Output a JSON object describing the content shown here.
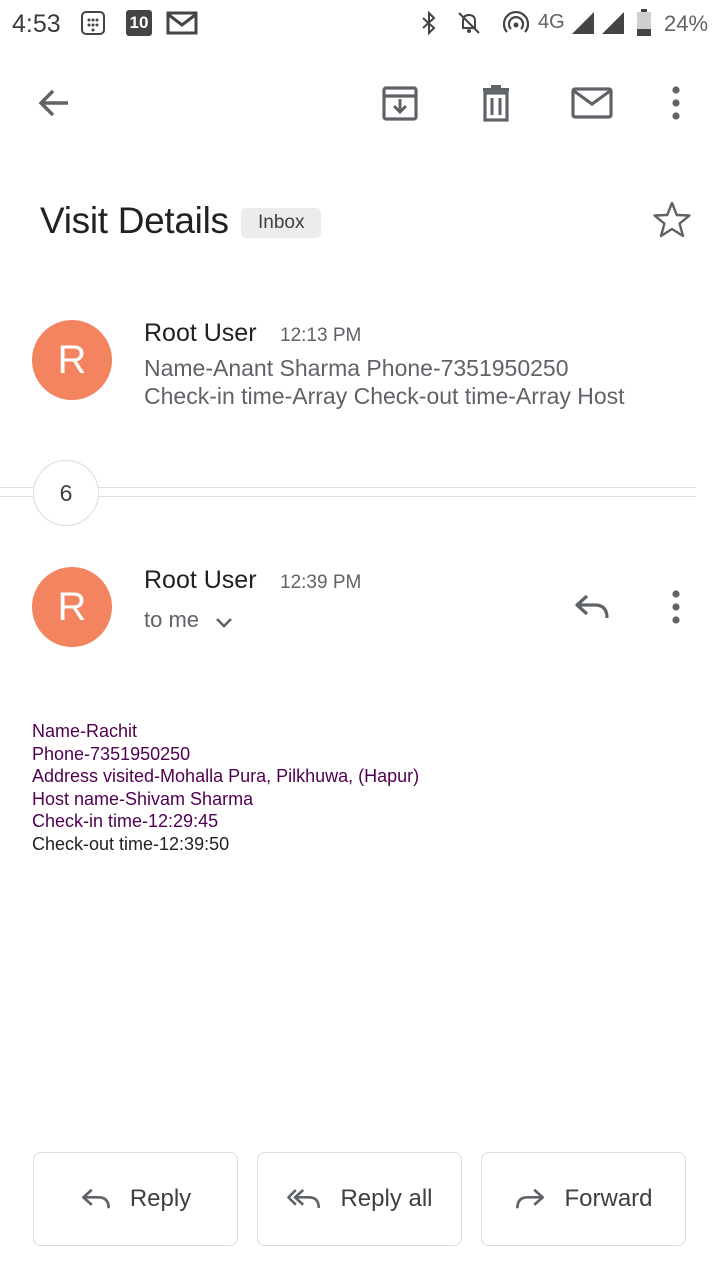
{
  "status_bar": {
    "time": "4:53",
    "notification_badge": "10",
    "network": "4G",
    "battery": "24%"
  },
  "toolbar": {
    "back_icon": "arrow-back-icon",
    "archive_icon": "archive-icon",
    "delete_icon": "delete-icon",
    "mark_unread_icon": "mail-icon",
    "more_icon": "more-vert-icon"
  },
  "email": {
    "subject": "Visit Details",
    "label": "Inbox"
  },
  "message_1": {
    "avatar_letter": "R",
    "sender": "Root User",
    "time": "12:13 PM",
    "snippet_line1": "Name-Anant Sharma Phone-7351950250",
    "snippet_line2": "Check-in time-Array Check-out time-Array Host"
  },
  "collapsed_count": "6",
  "message_2": {
    "avatar_letter": "R",
    "sender": "Root User",
    "time": "12:39 PM",
    "recipient": "to me",
    "body": [
      "Name-Rachit",
      "Phone-7351950250",
      "Address visited-Mohalla Pura, Pilkhuwa, (Hapur)",
      "Host name-Shivam Sharma",
      "Check-in time-12:29:45",
      "Check-out time-12:39:50"
    ]
  },
  "actions": {
    "reply": "Reply",
    "reply_all": "Reply all",
    "forward": "Forward"
  },
  "colors": {
    "avatar": "#f4845f",
    "quoted_text": "#500050"
  }
}
